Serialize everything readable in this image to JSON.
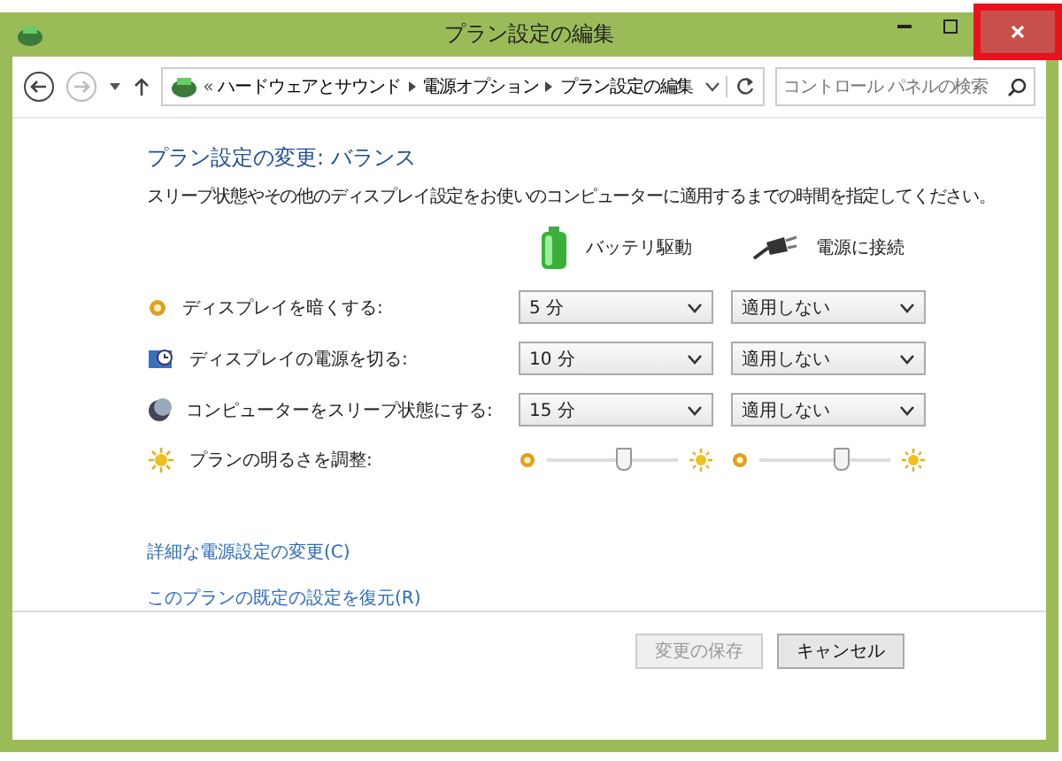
{
  "window": {
    "title": "プラン設定の編集",
    "close_highlighted": true
  },
  "nav": {
    "back_disabled": false,
    "forward_disabled": true
  },
  "breadcrumb": {
    "overflow": "«",
    "items": [
      "ハードウェアとサウンド",
      "電源オプション",
      "プラン設定の編集"
    ]
  },
  "search": {
    "placeholder": "コントロール パネルの検索"
  },
  "heading": "プラン設定の変更: バランス",
  "description": "スリープ状態やその他のディスプレイ設定をお使いのコンピューターに適用するまでの時間を指定してください。",
  "columns": [
    {
      "label": "バッテリ駆動",
      "kind": "battery"
    },
    {
      "label": "電源に接続",
      "kind": "plug"
    }
  ],
  "settings": [
    {
      "kind": "dropdown",
      "label": "ディスプレイを暗くする:",
      "values": [
        "5 分",
        "適用しない"
      ]
    },
    {
      "kind": "dropdown",
      "label": "ディスプレイの電源を切る:",
      "values": [
        "10 分",
        "適用しない"
      ]
    },
    {
      "kind": "dropdown",
      "label": "コンピューターをスリープ状態にする:",
      "values": [
        "15 分",
        "適用しない"
      ]
    },
    {
      "kind": "slider",
      "label": "プランの明るさを調整:",
      "sliders": [
        {
          "level": 0.6
        },
        {
          "level": 0.63
        }
      ]
    }
  ],
  "links": [
    "詳細な電源設定の変更(C)",
    "このプランの既定の設定を復元(R)"
  ],
  "buttons": [
    {
      "label": "変更の保存",
      "disabled": true
    },
    {
      "label": "キャンセル",
      "disabled": false
    }
  ]
}
